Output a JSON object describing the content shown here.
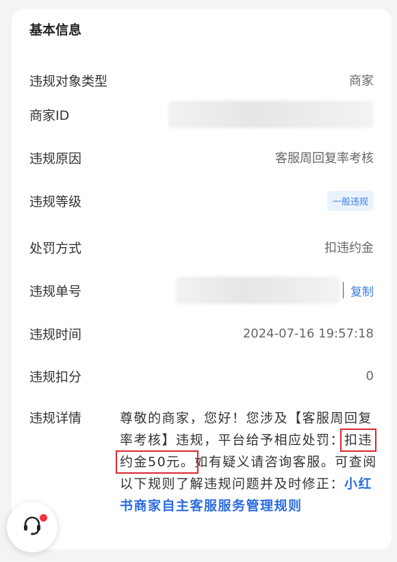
{
  "section_title": "基本信息",
  "rows": [
    {
      "label": "违规对象类型",
      "value": "商家"
    },
    {
      "label": "商家ID",
      "value": ""
    },
    {
      "label": "违规原因",
      "value": "客服周回复率考核"
    },
    {
      "label": "违规等级",
      "value": "一般违规"
    },
    {
      "label": "处罚方式",
      "value": "扣违约金"
    },
    {
      "label": "违规单号",
      "value": "",
      "action": "复制"
    },
    {
      "label": "违规时间",
      "value": "2024-07-16 19:57:18"
    },
    {
      "label": "违规扣分",
      "value": "0"
    }
  ],
  "detail": {
    "label": "违规详情",
    "text_before": "尊敬的商家，您好！您涉及【客服周回复率考核】违规，平台给予相应处罚：",
    "highlight": "扣违约金50元。",
    "text_after": "如有疑义请咨询客服。可查阅以下规则了解违规问题并及时修正：",
    "link": "小红书商家自主客服服务管理规则"
  },
  "colors": {
    "accent": "#3b7fe2",
    "highlight_border": "#d9252c",
    "badge_dot": "#f2333d"
  },
  "support_button_icon": "customer-service-headset-icon"
}
